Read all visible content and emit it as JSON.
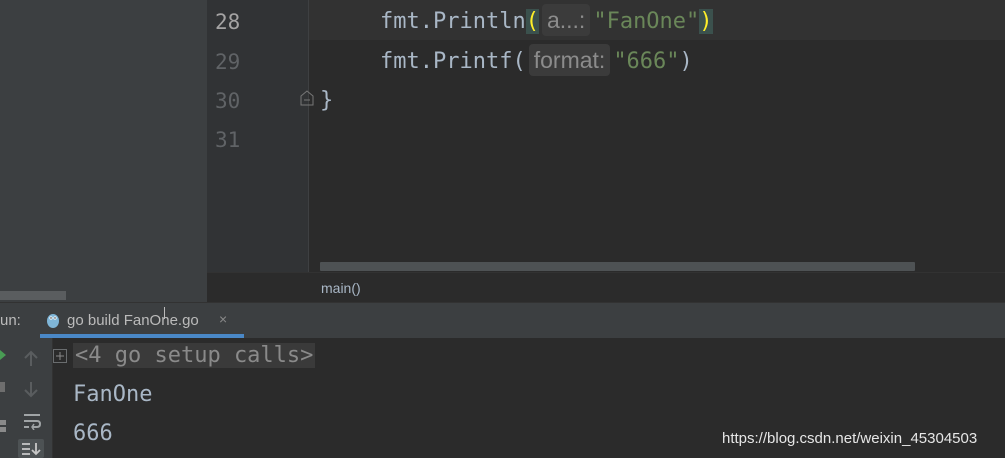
{
  "editor": {
    "line_numbers": [
      "28",
      "29",
      "30",
      "31"
    ],
    "lines": {
      "l28": {
        "pkg": "fmt",
        "dot": ".",
        "fn": "Println",
        "open": "(",
        "hint": "a...:",
        "arg": "\"FanOne\"",
        "close": ")"
      },
      "l29": {
        "pkg": "fmt",
        "dot": ".",
        "fn": "Printf",
        "open": "(",
        "hint": "format:",
        "arg": "\"666\"",
        "close": ")"
      },
      "l30": {
        "text": "}"
      }
    },
    "breadcrumb": "main()"
  },
  "run_panel": {
    "label": "un:",
    "tab_label": "go build FanOne.go",
    "tab_close": "×",
    "console": {
      "fold_sign": "+",
      "setup_calls": "<4 go setup calls>",
      "output_lines": [
        "FanOne",
        "666"
      ]
    },
    "toolbar_icons": [
      "arrow-up-icon",
      "arrow-down-icon",
      "soft-wrap-icon",
      "scroll-to-end-icon"
    ]
  },
  "watermark": "https://blog.csdn.net/weixin_45304503",
  "colors": {
    "editor_bg": "#2b2b2b",
    "panel_bg": "#3c3f41",
    "string": "#6a8759",
    "text": "#a9b7c6",
    "paren_highlight": "#ffef28",
    "tab_underline": "#4a88c7"
  }
}
